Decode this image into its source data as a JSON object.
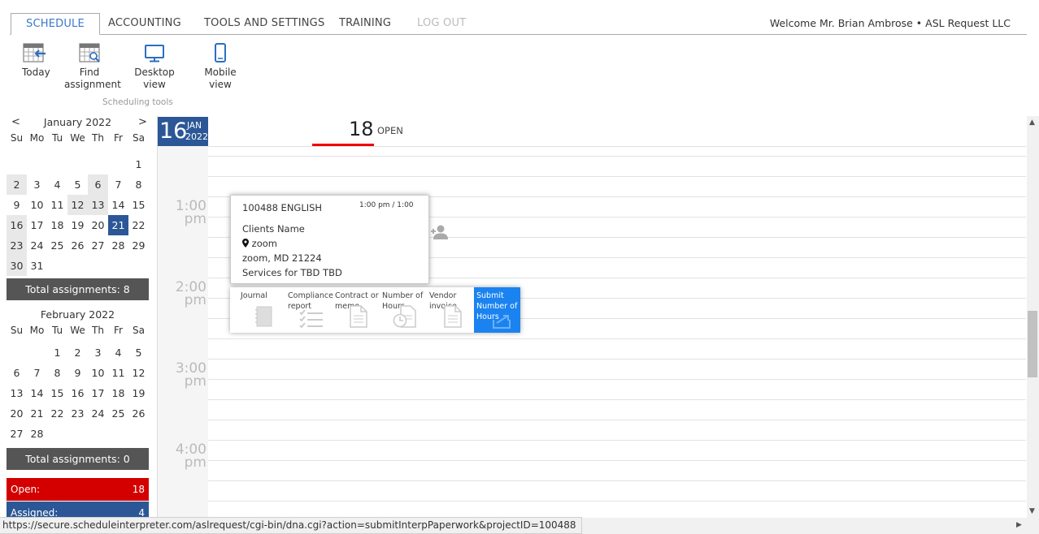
{
  "tabs": [
    {
      "label": "SCHEDULE"
    },
    {
      "label": "ACCOUNTING"
    },
    {
      "label": "TOOLS AND SETTINGS"
    },
    {
      "label": "TRAINING"
    },
    {
      "label": "LOG OUT"
    }
  ],
  "welcome": "Welcome Mr. Brian Ambrose • ASL Request LLC",
  "tools": {
    "today": "Today",
    "find1": "Find",
    "find2": "assignment",
    "desktop": "Desktop view",
    "mobile": "Mobile view",
    "group_label": "Scheduling tools"
  },
  "calendar_jan": {
    "prev": "<",
    "next": ">",
    "title": "January 2022",
    "dow": [
      "Su",
      "Mo",
      "Tu",
      "We",
      "Th",
      "Fr",
      "Sa"
    ],
    "total": "Total assignments: 8"
  },
  "calendar_feb": {
    "title": "February 2022",
    "dow": [
      "Su",
      "Mo",
      "Tu",
      "We",
      "Th",
      "Fr",
      "Sa"
    ],
    "total": "Total assignments: 0"
  },
  "stats": {
    "open_label": "Open:",
    "open_value": "18",
    "open_color": "#d40000",
    "assigned_label": "Assigned:",
    "assigned_value": "4",
    "assigned_color": "#2b5797"
  },
  "dayview": {
    "day": "16",
    "month": "JAN",
    "year": "2022",
    "count": "18",
    "count_label": "OPEN"
  },
  "times": [
    {
      "t": "1:00",
      "p": "pm"
    },
    {
      "t": "2:00",
      "p": "pm"
    },
    {
      "t": "3:00",
      "p": "pm"
    },
    {
      "t": "4:00",
      "p": "pm"
    }
  ],
  "assignment": {
    "id": "100488  ENGLISH",
    "time": "1:00 pm / 1:00",
    "client": "Clients Name",
    "location": "zoom",
    "address": "zoom, MD 21224",
    "services": "Services for TBD TBD"
  },
  "actions": {
    "journal": "Journal",
    "compliance1": "Compliance",
    "compliance2": "report",
    "contract1": "Contract or",
    "contract2": "memo",
    "hours1": "Number of",
    "hours2": "Hours",
    "vendor1": "Vendor",
    "vendor2": "invoice",
    "submit1": "Submit",
    "submit2": "Number of",
    "submit3": "Hours"
  },
  "status_url": "https://secure.scheduleinterpreter.com/aslrequest/cgi-bin/dna.cgi?action=submitInterpPaperwork&projectID=100488"
}
